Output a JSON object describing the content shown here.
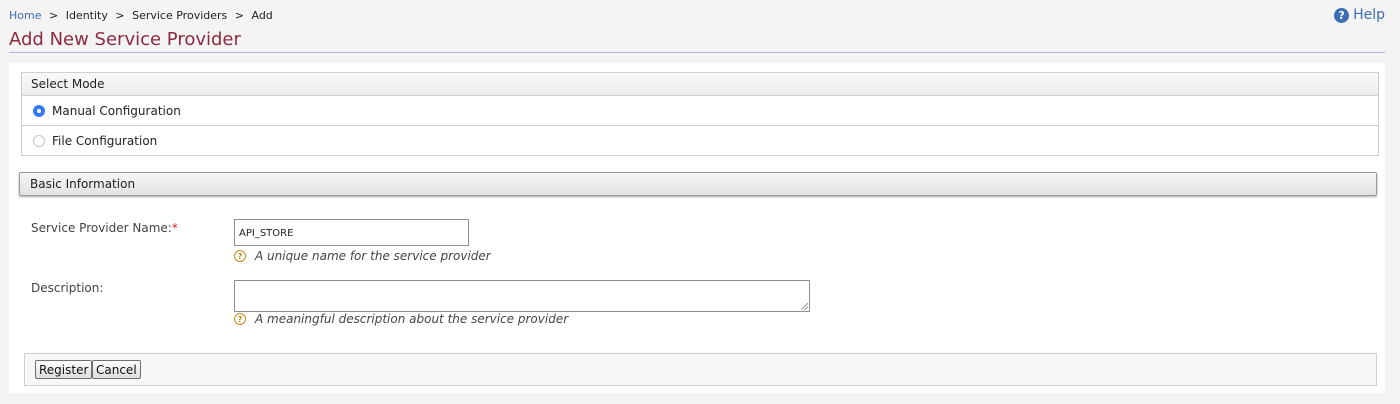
{
  "breadcrumb": {
    "home": "Home",
    "separator": ">",
    "identity": "Identity",
    "service_providers": "Service Providers",
    "current": "Add"
  },
  "help": {
    "icon": "question-circle-icon",
    "label": "Help"
  },
  "page_title": "Add New Service Provider",
  "select_mode": {
    "title": "Select Mode",
    "options": [
      {
        "label": "Manual Configuration",
        "checked": true
      },
      {
        "label": "File Configuration",
        "checked": false
      }
    ]
  },
  "basic_information": {
    "title": "Basic Information",
    "name_label": "Service Provider Name:",
    "name_required_mark": "*",
    "name_value": "API_STORE",
    "name_hint": "A unique name for the service provider",
    "description_label": "Description:",
    "description_value": "",
    "description_hint": "A meaningful description about the service provider"
  },
  "buttons": {
    "register": "Register",
    "cancel": "Cancel"
  },
  "colors": {
    "title": "#8c2a3f",
    "link": "#3d6db5",
    "radio_checked": "#3478f6",
    "required": "#d02828"
  }
}
